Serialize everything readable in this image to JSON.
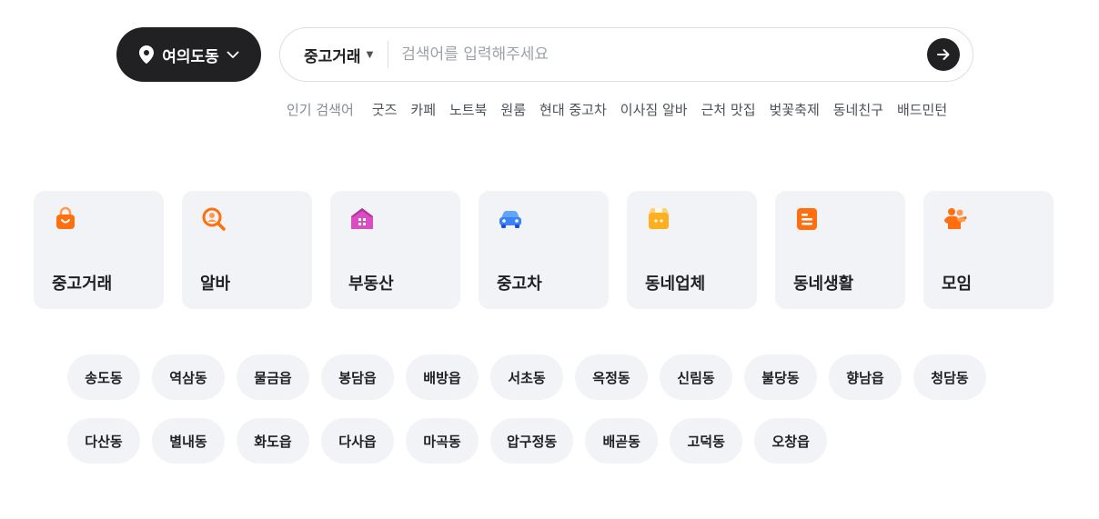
{
  "location": {
    "label": "여의도동"
  },
  "search": {
    "category": "중고거래",
    "placeholder": "검색어를 입력해주세요"
  },
  "popular": {
    "label": "인기 검색어",
    "keywords": [
      "굿즈",
      "카페",
      "노트북",
      "원룸",
      "현대 중고차",
      "이사짐 알바",
      "근처 맛집",
      "벚꽃축제",
      "동네친구",
      "배드민턴"
    ]
  },
  "categories": [
    {
      "label": "중고거래",
      "icon": "shopping-bag-icon",
      "color": "#ff6f0f"
    },
    {
      "label": "알바",
      "icon": "job-search-icon",
      "color": "#ff6f0f"
    },
    {
      "label": "부동산",
      "icon": "house-icon",
      "color": "#d94ec3"
    },
    {
      "label": "중고차",
      "icon": "car-icon",
      "color": "#3b82f6"
    },
    {
      "label": "동네업체",
      "icon": "store-icon",
      "color": "#ffb020"
    },
    {
      "label": "동네생활",
      "icon": "document-icon",
      "color": "#ff6f0f"
    },
    {
      "label": "모임",
      "icon": "people-icon",
      "color": "#ff6f0f"
    }
  ],
  "regions": [
    "송도동",
    "역삼동",
    "물금읍",
    "봉담읍",
    "배방읍",
    "서초동",
    "옥정동",
    "신림동",
    "불당동",
    "향남읍",
    "청담동",
    "다산동",
    "별내동",
    "화도읍",
    "다사읍",
    "마곡동",
    "압구정동",
    "배곧동",
    "고덕동",
    "오창읍"
  ]
}
